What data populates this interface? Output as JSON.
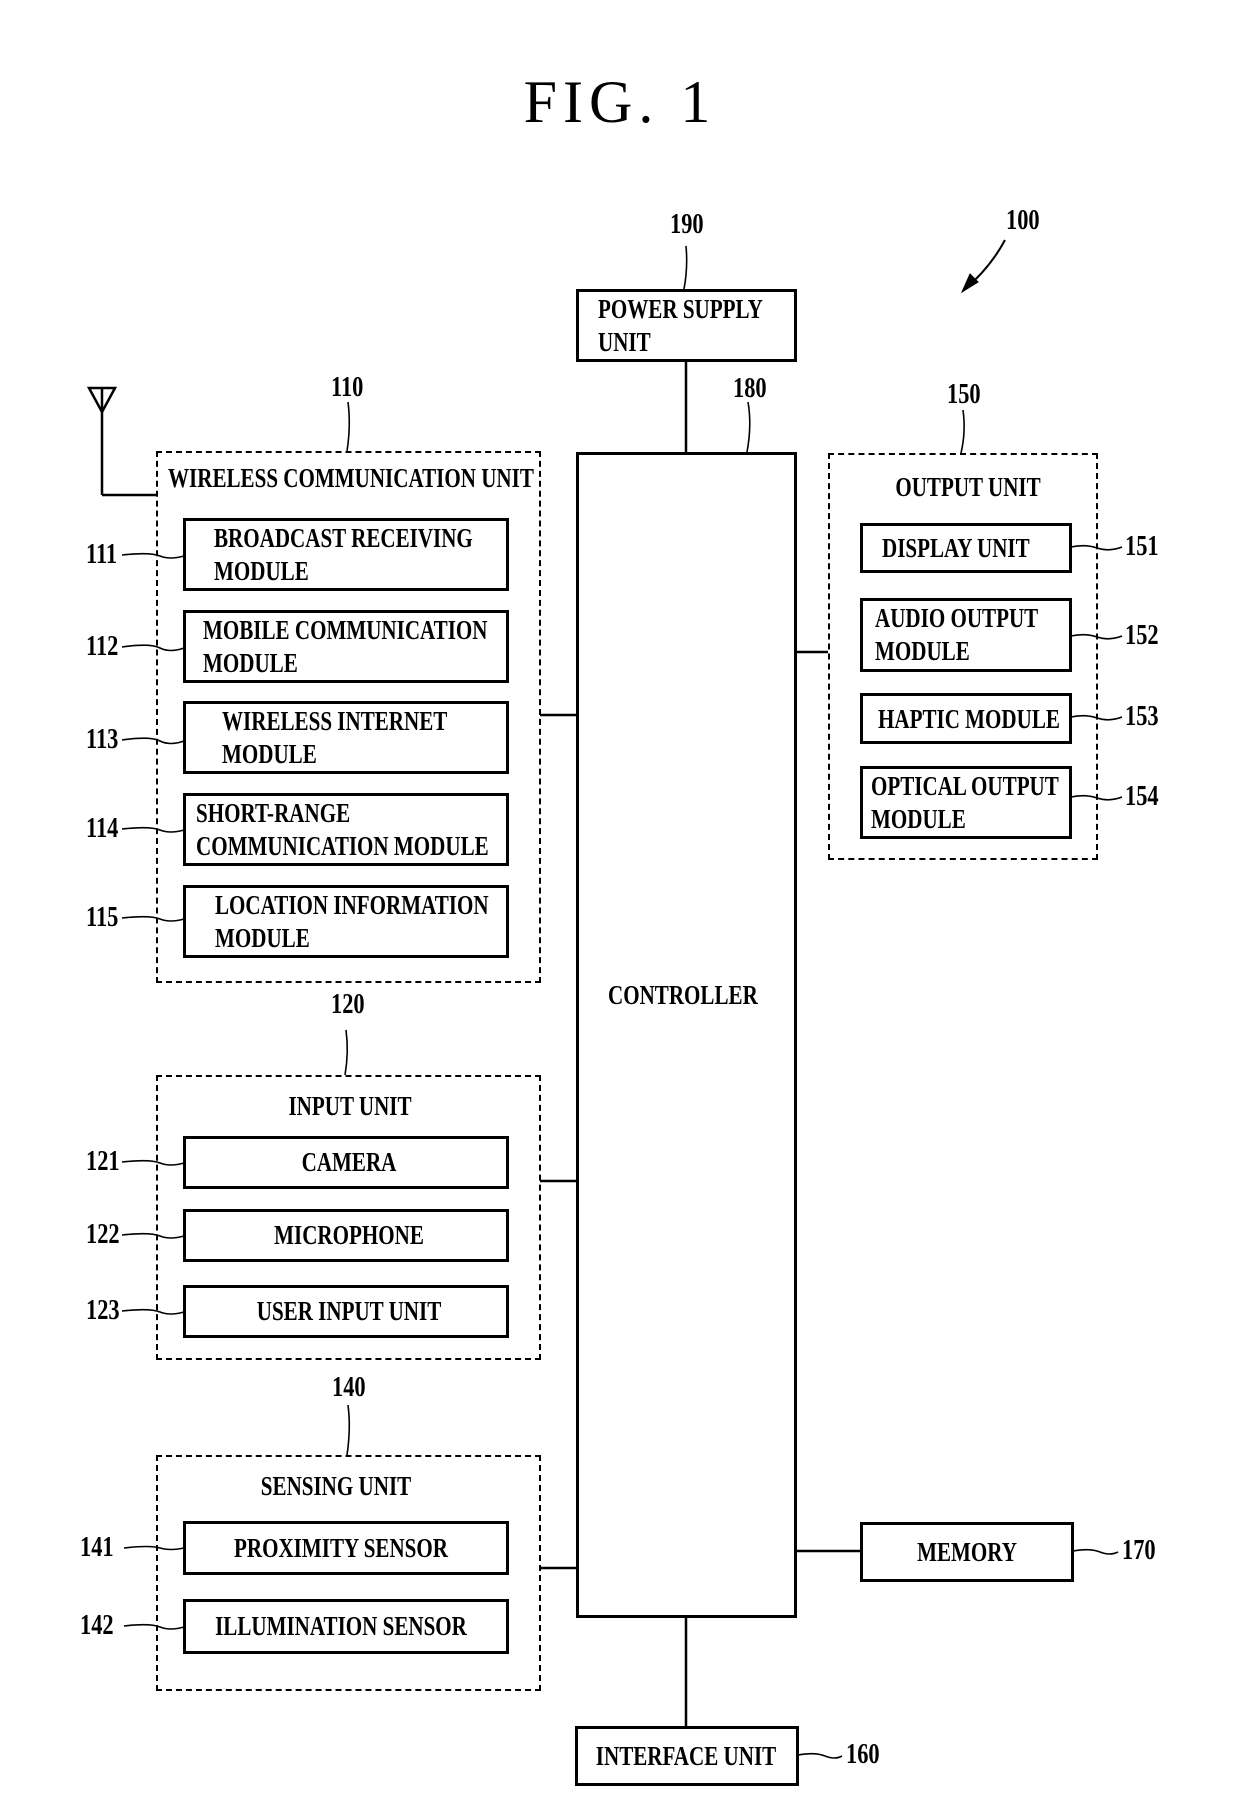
{
  "figure": {
    "title": "FIG.  1",
    "device_ref": "100"
  },
  "power_supply": {
    "ref": "190",
    "line1": "POWER SUPPLY",
    "line2": "UNIT"
  },
  "controller": {
    "ref": "180",
    "label": "CONTROLLER"
  },
  "wireless_unit": {
    "ref": "110",
    "label": "WIRELESS COMMUNICATION UNIT",
    "modules": [
      {
        "ref": "111",
        "line1": "BROADCAST RECEIVING",
        "line2": "MODULE"
      },
      {
        "ref": "112",
        "line1": "MOBILE COMMUNICATION",
        "line2": "MODULE"
      },
      {
        "ref": "113",
        "line1": "WIRELESS INTERNET",
        "line2": "MODULE"
      },
      {
        "ref": "114",
        "line1": "SHORT-RANGE",
        "line2": "COMMUNICATION MODULE"
      },
      {
        "ref": "115",
        "line1": "LOCATION INFORMATION",
        "line2": "MODULE"
      }
    ]
  },
  "input_unit": {
    "ref": "120",
    "label": "INPUT UNIT",
    "modules": [
      {
        "ref": "121",
        "label": "CAMERA"
      },
      {
        "ref": "122",
        "label": "MICROPHONE"
      },
      {
        "ref": "123",
        "label": "USER INPUT UNIT"
      }
    ]
  },
  "sensing_unit": {
    "ref": "140",
    "label": "SENSING UNIT",
    "modules": [
      {
        "ref": "141",
        "label": "PROXIMITY SENSOR"
      },
      {
        "ref": "142",
        "label": "ILLUMINATION SENSOR"
      }
    ]
  },
  "output_unit": {
    "ref": "150",
    "label": "OUTPUT UNIT",
    "modules": [
      {
        "ref": "151",
        "line1": "DISPLAY UNIT",
        "line2": ""
      },
      {
        "ref": "152",
        "line1": "AUDIO OUTPUT",
        "line2": "MODULE"
      },
      {
        "ref": "153",
        "line1": "HAPTIC MODULE",
        "line2": ""
      },
      {
        "ref": "154",
        "line1": "OPTICAL OUTPUT",
        "line2": "MODULE"
      }
    ]
  },
  "interface_unit": {
    "ref": "160",
    "label": "INTERFACE UNIT"
  },
  "memory": {
    "ref": "170",
    "label": "MEMORY"
  }
}
